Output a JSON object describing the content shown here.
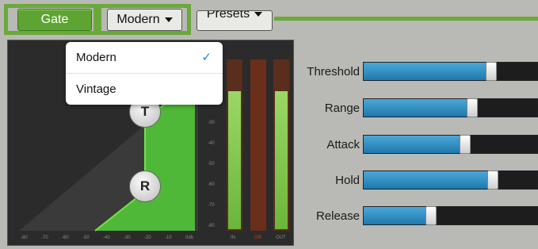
{
  "toolbar": {
    "gate_label": "Gate",
    "mode_label": "Modern",
    "presets_label": "Presets",
    "accent": "#6aa93a"
  },
  "dropdown": {
    "items": [
      {
        "label": "Modern",
        "checked": true
      },
      {
        "label": "Vintage",
        "checked": false
      }
    ],
    "check_icon": "checkmark-icon"
  },
  "graph": {
    "knob_threshold": "T",
    "knob_range": "R",
    "x_ticks": [
      "-80",
      "-70",
      "-60",
      "-50",
      "-40",
      "-30",
      "-20",
      "-10",
      "0db"
    ],
    "y_ticks": [
      "-30",
      "-40",
      "-50",
      "-60",
      "-70",
      "-80"
    ]
  },
  "meters": {
    "labels": [
      "IN",
      "GR",
      "OUT"
    ],
    "in_level": 0.82,
    "out_level": 0.82
  },
  "params": [
    {
      "label": "Threshold",
      "value": 0.97
    },
    {
      "label": "Range",
      "value": 0.82
    },
    {
      "label": "Attack",
      "value": 0.76
    },
    {
      "label": "Hold",
      "value": 0.98
    },
    {
      "label": "Release",
      "value": 0.49
    }
  ]
}
